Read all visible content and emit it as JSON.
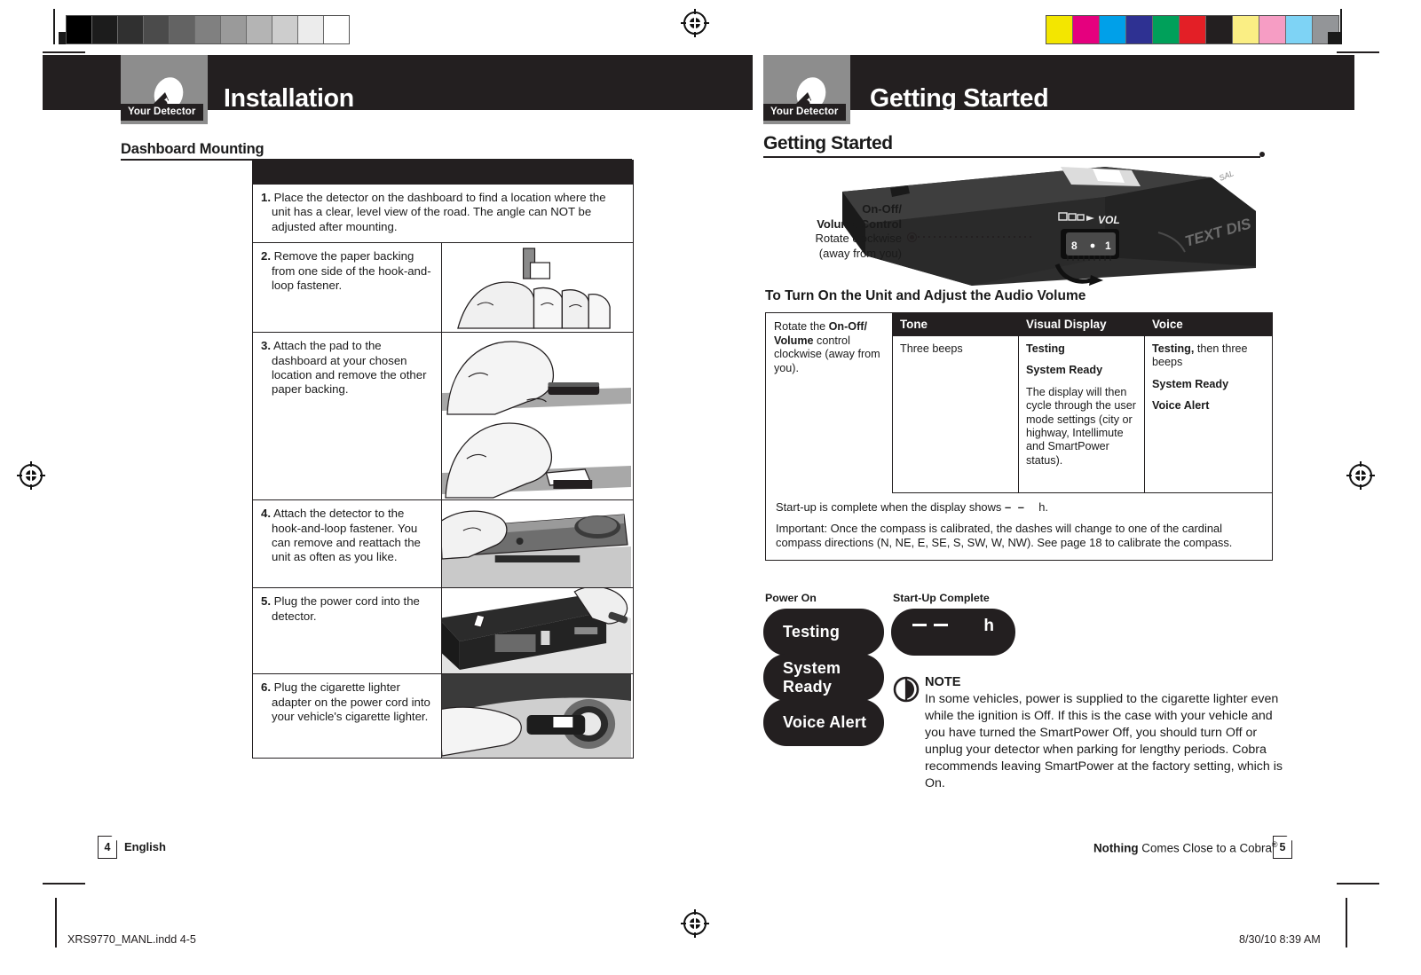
{
  "print_marks": {
    "gray_wedge": [
      "#000000",
      "#1c1c1c",
      "#303030",
      "#4b4b4b",
      "#636363",
      "#808080",
      "#9a9a9a",
      "#b4b4b4",
      "#cdcdcd",
      "#ececec",
      "#ffffff"
    ],
    "color_wedge": [
      "#f3e600",
      "#e5007e",
      "#00a0e9",
      "#2e3192",
      "#00a05a",
      "#e31f26",
      "#231f20",
      "#faee84",
      "#f69dc4",
      "#7ed3f5",
      "#939598"
    ],
    "registration_icon": "registration-target-icon"
  },
  "left_page": {
    "chapter": {
      "tab_label": "Your Detector",
      "title": "Installation",
      "logo_icon": "cobra-detector-logo-icon"
    },
    "section_title": "Dashboard Mounting",
    "steps": [
      {
        "number": "1.",
        "text": "Place the detector on the dashboard to find a location where the unit has a clear, level view of the road. The angle can NOT be adjusted after mounting.",
        "illustration": "none"
      },
      {
        "number": "2.",
        "text": "Remove the paper backing from one side of the hook-and-loop fastener.",
        "illustration": "hands-peeling-paper-backing"
      },
      {
        "number": "3.",
        "text": "Attach the pad to the dashboard at your chosen location and remove the other paper backing.",
        "illustration": "hand-pressing-pad-on-dashboard"
      },
      {
        "number": "4.",
        "text": "Attach the detector to the hook-and-loop fastener. You can remove and reattach the unit as often as you like.",
        "illustration": "hand-attaching-detector"
      },
      {
        "number": "5.",
        "text": "Plug the power cord into the detector.",
        "illustration": "hand-plugging-power-cord"
      },
      {
        "number": "6.",
        "text": "Plug the cigarette lighter adapter on the power cord into your vehicle's cigarette lighter.",
        "illustration": "plugging-adapter-into-lighter-socket"
      }
    ],
    "footer": {
      "page_number": "4",
      "language": "English"
    }
  },
  "right_page": {
    "chapter": {
      "tab_label": "Your Detector",
      "title": "Getting Started",
      "logo_icon": "cobra-detector-logo-icon"
    },
    "section_title": "Getting Started",
    "device_callout": {
      "line1": "On-Off/",
      "line2": "Volume Control",
      "line3": "Rotate clockwise",
      "line4": "(away from you)",
      "device_marking_vol": "VOL",
      "device_marking_8": "8",
      "device_marking_1": "1",
      "device_marking_text_display": "TEXT DISPLAY"
    },
    "turn_on": {
      "title": "To Turn On the Unit and Adjust the Audio Volume",
      "rotate_instruction": {
        "prefix": "Rotate the ",
        "bold1": "On-Off/",
        "bold2": "Volume",
        "suffix": " control clockwise (away from you)."
      },
      "columns": [
        "Tone",
        "Visual Display",
        "Voice"
      ],
      "row": {
        "tone": "Three beeps",
        "visual_display": [
          {
            "text": "Testing",
            "bold": true
          },
          {
            "text": "System Ready",
            "bold": true
          },
          {
            "text": "The display will then cycle through the user mode settings (city or highway, Intellimute and SmartPower status).",
            "bold": false
          }
        ],
        "voice": [
          {
            "bold_part": "Testing,",
            "rest": " then three beeps"
          },
          {
            "bold_part": "System Ready",
            "rest": ""
          },
          {
            "bold_part": "Voice Alert",
            "rest": ""
          }
        ]
      },
      "startup_note_1_a": "Start-up is complete when the display shows ",
      "startup_note_1_dashes": "– –",
      "startup_note_1_b": "    h.",
      "startup_note_2": "Important: Once the compass is calibrated, the dashes will change to one of the cardinal compass directions (N, NE, E, SE, S, SW, W, NW). See page 18 to calibrate the compass."
    },
    "display_demo": {
      "power_on_label": "Power On",
      "startup_complete_label": "Start-Up Complete",
      "pills": [
        "Testing",
        "System Ready",
        "Voice Alert"
      ],
      "lcd_reading": "– –        h"
    },
    "note": {
      "icon": "note-circle-icon",
      "title": "NOTE",
      "body": "In some vehicles, power is supplied to the cigarette lighter even while the ignition is Off. If this is the case with your vehicle and you have turned the SmartPower Off, you should turn Off or unplug your detector when parking for lengthy periods. Cobra recommends leaving SmartPower at the factory setting, which is On."
    },
    "footer": {
      "tagline_bold": "Nothing",
      "tagline_rest": " Comes Close to a Cobra",
      "tagline_reg": "®",
      "page_number": "5"
    }
  },
  "production": {
    "filename": "XRS9770_MANL.indd   4-5",
    "timestamp": "8/30/10   8:39 AM"
  }
}
